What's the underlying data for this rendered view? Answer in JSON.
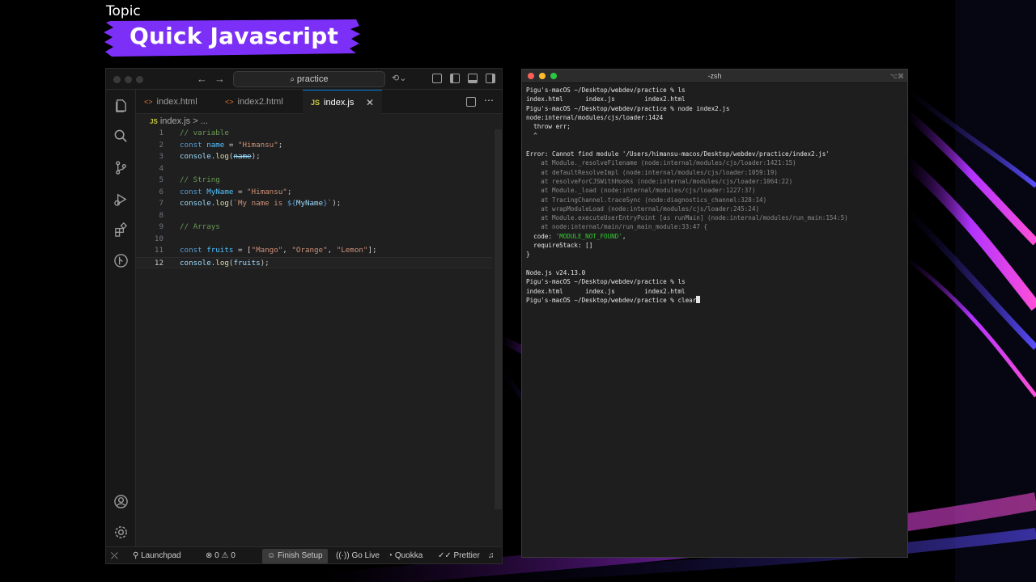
{
  "topic": {
    "label": "Topic",
    "title": "Quick Javascript"
  },
  "vscode": {
    "search_text": "practice",
    "tabs": [
      {
        "label": "index.html",
        "icon": "html-file-icon"
      },
      {
        "label": "index2.html",
        "icon": "html-file-icon"
      },
      {
        "label": "index.js",
        "icon": "js-file-icon",
        "active": true
      }
    ],
    "js_badge": "JS",
    "breadcrumb": {
      "file": "index.js",
      "sep": ">",
      "rest": "..."
    },
    "lines": [
      {
        "n": "1",
        "tokens": [
          [
            "c-com",
            "// variable"
          ]
        ]
      },
      {
        "n": "2",
        "tokens": [
          [
            "c-kw",
            "const "
          ],
          [
            "c-const",
            "name"
          ],
          [
            "",
            " = "
          ],
          [
            "c-str",
            "\"Himansu\""
          ],
          [
            "",
            ";"
          ]
        ]
      },
      {
        "n": "3",
        "tokens": [
          [
            "c-var",
            "console"
          ],
          [
            "",
            "."
          ],
          [
            "c-fn",
            "log"
          ],
          [
            "",
            "("
          ],
          [
            "c-strike",
            "name"
          ],
          [
            "",
            ");"
          ]
        ]
      },
      {
        "n": "4",
        "tokens": []
      },
      {
        "n": "5",
        "tokens": [
          [
            "c-com",
            "// String"
          ]
        ]
      },
      {
        "n": "6",
        "tokens": [
          [
            "c-kw",
            "const "
          ],
          [
            "c-const",
            "MyName"
          ],
          [
            "",
            " = "
          ],
          [
            "c-str",
            "\"Himansu\""
          ],
          [
            "",
            ";"
          ]
        ]
      },
      {
        "n": "7",
        "tokens": [
          [
            "c-var",
            "console"
          ],
          [
            "",
            "."
          ],
          [
            "c-fn",
            "log"
          ],
          [
            "",
            "("
          ],
          [
            "c-str",
            "`My name is "
          ],
          [
            "c-kw",
            "${"
          ],
          [
            "c-var",
            "MyName"
          ],
          [
            "c-kw",
            "}"
          ],
          [
            "c-str",
            "`"
          ],
          [
            "",
            ");"
          ]
        ]
      },
      {
        "n": "8",
        "tokens": []
      },
      {
        "n": "9",
        "tokens": [
          [
            "c-com",
            "// Arrays"
          ]
        ]
      },
      {
        "n": "10",
        "tokens": []
      },
      {
        "n": "11",
        "tokens": [
          [
            "c-kw",
            "const "
          ],
          [
            "c-const",
            "fruits"
          ],
          [
            "",
            " = ["
          ],
          [
            "c-str",
            "\"Mango\""
          ],
          [
            "",
            ", "
          ],
          [
            "c-str",
            "\"Orange\""
          ],
          [
            "",
            ", "
          ],
          [
            "c-str",
            "\"Lemon\""
          ],
          [
            "",
            "];"
          ]
        ]
      },
      {
        "n": "12",
        "tokens": [
          [
            "c-var",
            "console"
          ],
          [
            "",
            "."
          ],
          [
            "c-fn",
            "log"
          ],
          [
            "",
            "("
          ],
          [
            "c-var",
            "fruits"
          ],
          [
            "",
            ");"
          ]
        ]
      }
    ],
    "status": {
      "launchpad": "Launchpad",
      "errors": "0",
      "warnings": "0",
      "finish_setup": "Finish Setup",
      "go_live": "Go Live",
      "quokka": "Quokka",
      "prettier": "Prettier"
    }
  },
  "terminal": {
    "title": "-zsh",
    "keys": "⌥⌘",
    "lines": [
      {
        "t": "Pigu's-macOS ~/Desktop/webdev/practice % ls",
        "c": ""
      },
      {
        "t": "index.html      index.js        index2.html",
        "c": ""
      },
      {
        "t": "Pigu's-macOS ~/Desktop/webdev/practice % node index2.js",
        "c": ""
      },
      {
        "t": "node:internal/modules/cjs/loader:1424",
        "c": ""
      },
      {
        "t": "  throw err;",
        "c": ""
      },
      {
        "t": "  ^",
        "c": ""
      },
      {
        "t": "",
        "c": ""
      },
      {
        "t": "Error: Cannot find module '/Users/himansu-macos/Desktop/webdev/practice/index2.js'",
        "c": ""
      },
      {
        "t": "    at Module._resolveFilename (node:internal/modules/cjs/loader:1421:15)",
        "c": "tl-dim"
      },
      {
        "t": "    at defaultResolveImpl (node:internal/modules/cjs/loader:1059:19)",
        "c": "tl-dim"
      },
      {
        "t": "    at resolveForCJSWithHooks (node:internal/modules/cjs/loader:1064:22)",
        "c": "tl-dim"
      },
      {
        "t": "    at Module._load (node:internal/modules/cjs/loader:1227:37)",
        "c": "tl-dim"
      },
      {
        "t": "    at TracingChannel.traceSync (node:diagnostics_channel:328:14)",
        "c": "tl-dim"
      },
      {
        "t": "    at wrapModuleLoad (node:internal/modules/cjs/loader:245:24)",
        "c": "tl-dim"
      },
      {
        "t": "    at Module.executeUserEntryPoint [as runMain] (node:internal/modules/run_main:154:5)",
        "c": "tl-dim"
      },
      {
        "t": "    at node:internal/main/run_main_module:33:47 {",
        "c": "tl-dim"
      },
      {
        "t": "  code: 'MODULE_NOT_FOUND',",
        "c": "code"
      },
      {
        "t": "  requireStack: []",
        "c": ""
      },
      {
        "t": "}",
        "c": ""
      },
      {
        "t": "",
        "c": ""
      },
      {
        "t": "Node.js v24.13.0",
        "c": ""
      },
      {
        "t": "Pigu's-macOS ~/Desktop/webdev/practice % ls",
        "c": ""
      },
      {
        "t": "index.html      index.js        index2.html",
        "c": ""
      },
      {
        "t": "Pigu's-macOS ~/Desktop/webdev/practice % clear",
        "c": "cursor"
      }
    ]
  },
  "colors": {
    "accent": "#0078d4",
    "banner": "#7b2ff7"
  }
}
